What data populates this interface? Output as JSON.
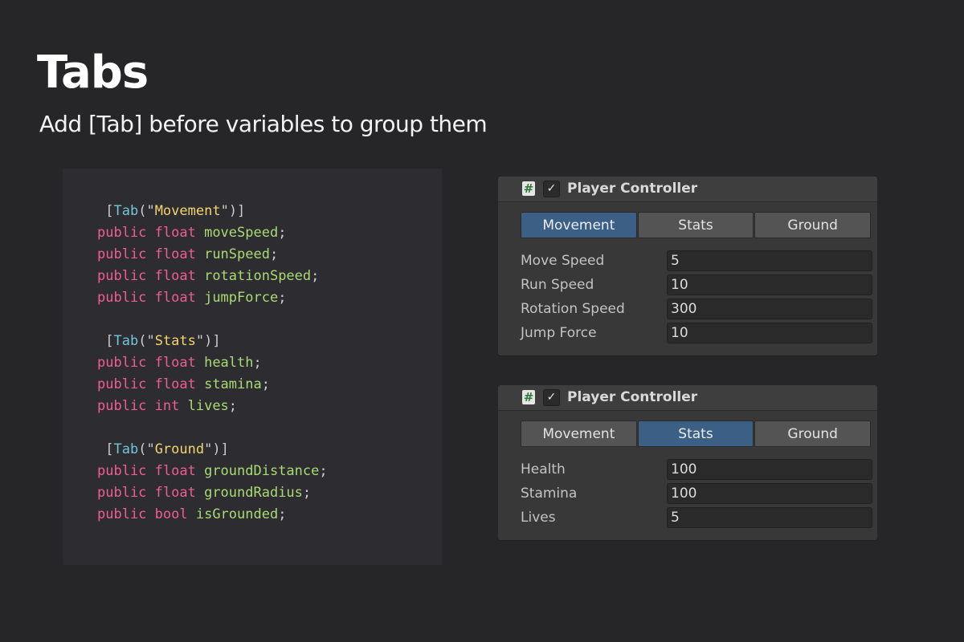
{
  "header": {
    "title": "Tabs",
    "subtitle": "Add [Tab] before variables to group them"
  },
  "code": {
    "movement_attr": "Movement",
    "movement_lines": [
      {
        "kw": "public float",
        "ident": "moveSpeed"
      },
      {
        "kw": "public float",
        "ident": "runSpeed"
      },
      {
        "kw": "public float",
        "ident": "rotationSpeed"
      },
      {
        "kw": "public float",
        "ident": "jumpForce"
      }
    ],
    "stats_attr": "Stats",
    "stats_lines": [
      {
        "kw": "public float",
        "ident": "health"
      },
      {
        "kw": "public float",
        "ident": "stamina"
      },
      {
        "kw": "public int",
        "ident": "lives"
      }
    ],
    "ground_attr": "Ground",
    "ground_lines": [
      {
        "kw": "public float",
        "ident": "groundDistance"
      },
      {
        "kw": "public float",
        "ident": "groundRadius"
      },
      {
        "kw": "public bool",
        "ident": "isGrounded"
      }
    ]
  },
  "inspector1": {
    "title": "Player Controller",
    "icon": "script-icon",
    "tabs": [
      "Movement",
      "Stats",
      "Ground"
    ],
    "active_tab": "Movement",
    "fields": [
      {
        "label": "Move Speed",
        "value": "5"
      },
      {
        "label": "Run Speed",
        "value": "10"
      },
      {
        "label": "Rotation Speed",
        "value": "300"
      },
      {
        "label": "Jump Force",
        "value": "10"
      }
    ]
  },
  "inspector2": {
    "title": "Player Controller",
    "icon": "script-icon",
    "tabs": [
      "Movement",
      "Stats",
      "Ground"
    ],
    "active_tab": "Stats",
    "fields": [
      {
        "label": "Health",
        "value": "100"
      },
      {
        "label": "Stamina",
        "value": "100"
      },
      {
        "label": "Lives",
        "value": "5"
      }
    ]
  },
  "colors": {
    "background": "#262628",
    "code_panel": "#2d2c31",
    "attribute": "#71c6d8",
    "string": "#f3d56d",
    "keyword": "#ef5e8f",
    "identifier": "#a9db72",
    "active_tab": "#3b5f85"
  }
}
